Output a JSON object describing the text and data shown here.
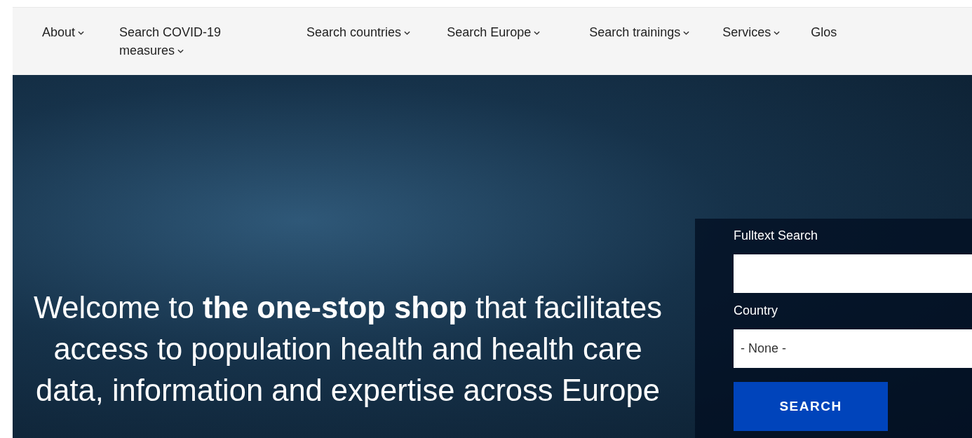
{
  "nav": {
    "items": [
      {
        "label": "About",
        "has_dropdown": true
      },
      {
        "label": "Search COVID-19 measures",
        "has_dropdown": true
      },
      {
        "label": "Search countries",
        "has_dropdown": true
      },
      {
        "label": "Search Europe",
        "has_dropdown": true
      },
      {
        "label": "Search trainings",
        "has_dropdown": true
      },
      {
        "label": "Services",
        "has_dropdown": true
      },
      {
        "label": "Glos",
        "has_dropdown": false
      }
    ]
  },
  "hero": {
    "headline": "Welcome to **the one-stop shop** that facilitates access to population health and health care data, information and expertise across Europe"
  },
  "search_panel": {
    "fulltext_label": "Fulltext Search",
    "country_label": "Country",
    "country_value": "- None -",
    "button": "SEARCH"
  }
}
